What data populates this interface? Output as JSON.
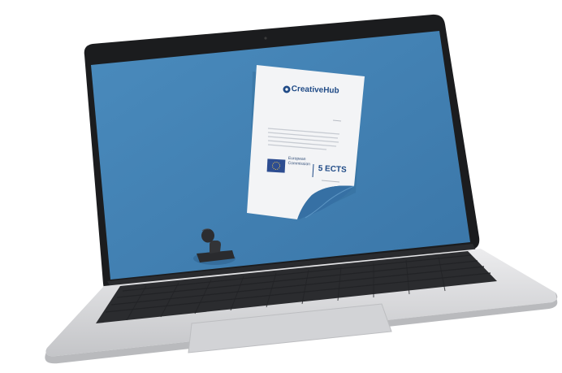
{
  "certificate": {
    "brand_name": "CreativeHub",
    "issuer_line1": "European",
    "issuer_line2": "Commission",
    "credits": "5 ECTS"
  },
  "colors": {
    "screen_blue": "#3f7fb2",
    "certificate_paper": "#f3f4f6",
    "brand_text": "#1f4a86",
    "laptop_body": "#d9dadd",
    "bezel": "#1b1c1e",
    "keys": "#3a3b3d"
  },
  "icons": {
    "brand_logo": "creativehub-logo-icon",
    "eu_flag": "eu-flag-icon",
    "stamp": "rubber-stamp-icon"
  }
}
